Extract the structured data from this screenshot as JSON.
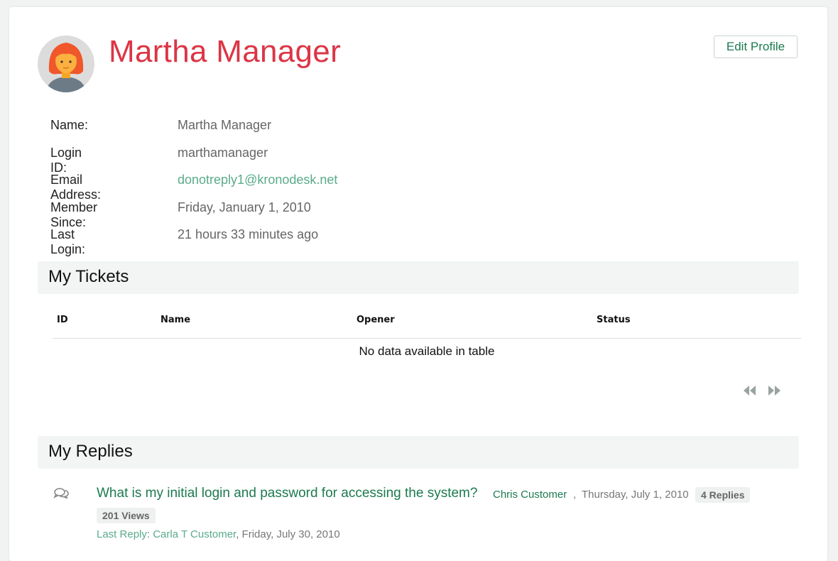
{
  "profile": {
    "name": "Martha Manager",
    "edit_label": "Edit Profile"
  },
  "info": {
    "rows": [
      {
        "label": "Name:",
        "value": "Martha Manager"
      },
      {
        "label": "Login ID:",
        "value": "marthamanager"
      },
      {
        "label": "Email Address:",
        "value": "donotreply1@kronodesk.net"
      },
      {
        "label": "Member Since:",
        "value": "Friday, January 1, 2010"
      },
      {
        "label": "Last Login:",
        "value": "21 hours 33 minutes ago"
      }
    ]
  },
  "tickets": {
    "heading": "My Tickets",
    "columns": [
      "ID",
      "Name",
      "Opener",
      "Status"
    ],
    "empty_message": "No data available in table",
    "pager_icons": [
      "double-chevron-left-icon",
      "double-chevron-right-icon"
    ]
  },
  "replies": {
    "heading": "My Replies",
    "items": [
      {
        "icon": "comments-icon",
        "title": "What is my initial login and password for accessing the system?",
        "author": "Chris Customer",
        "separator": ",",
        "date": "Thursday, July 1, 2010",
        "replies_badge": "4 Replies",
        "views_badge": "201 Views",
        "last_reply_label": "Last Reply",
        "last_reply_colon": ":",
        "last_reply_name": "Carla T Customer",
        "last_reply_date": ", Friday, July 30, 2010"
      }
    ]
  },
  "colors": {
    "title_red": "#dc3545",
    "link_green": "#1c7a50",
    "light_green": "#5aab8b",
    "section_bg": "#f2f5f3"
  }
}
